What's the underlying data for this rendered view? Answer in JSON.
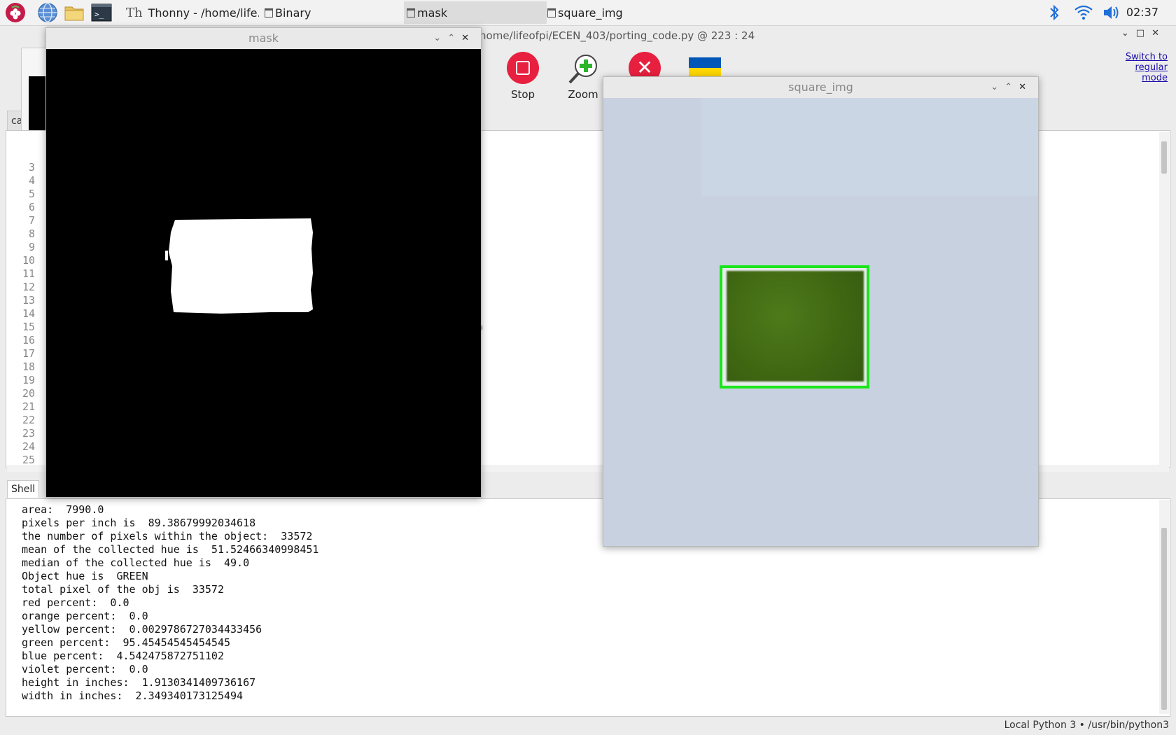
{
  "taskbar": {
    "tasks": [
      {
        "label": "Thonny  -  /home/life..."
      },
      {
        "label": "Binary"
      },
      {
        "label": "mask"
      },
      {
        "label": "square_img"
      }
    ],
    "clock": "02:37"
  },
  "thonny": {
    "title": "/home/lifeofpi/ECEN_403/porting_code.py  @  223 : 24",
    "toolbar": {
      "stop_label": "Stop",
      "zoom_label": "Zoom"
    },
    "switch_mode": "Switch to regular mode",
    "editor_tab_fragment": "ca",
    "editor_paren": ")",
    "line_numbers": [
      "3",
      "4",
      "5",
      "6",
      "7",
      "8",
      "9",
      "10",
      "11",
      "12",
      "13",
      "14",
      "15",
      "16",
      "17",
      "18",
      "19",
      "20",
      "21",
      "22",
      "23",
      "24",
      "25"
    ],
    "shell_tab": "Shell",
    "shell_lines": [
      "area:  7990.0",
      "pixels per inch is  89.38679992034618",
      "the number of pixels within the object:  33572",
      "mean of the collected hue is  51.52466340998451",
      "median of the collected hue is  49.0",
      "Object hue is  GREEN",
      "total pixel of the obj is  33572",
      "red percent:  0.0",
      "orange percent:  0.0",
      "yellow percent:  0.0029786727034433456",
      "green percent:  95.45454545454545",
      "blue percent:  4.542475872751102",
      "violet percent:  0.0",
      "height in inches:  1.9130341409736167",
      "width in inches:  2.349340173125494"
    ],
    "status": "Local Python 3  •  /usr/bin/python3"
  },
  "mask_window": {
    "title": "mask"
  },
  "square_window": {
    "title": "square_img"
  },
  "colors": {
    "stop_red": "#e8203f",
    "box_green": "#19e619",
    "flag_blue": "#0057b7",
    "flag_yellow": "#ffd700"
  }
}
